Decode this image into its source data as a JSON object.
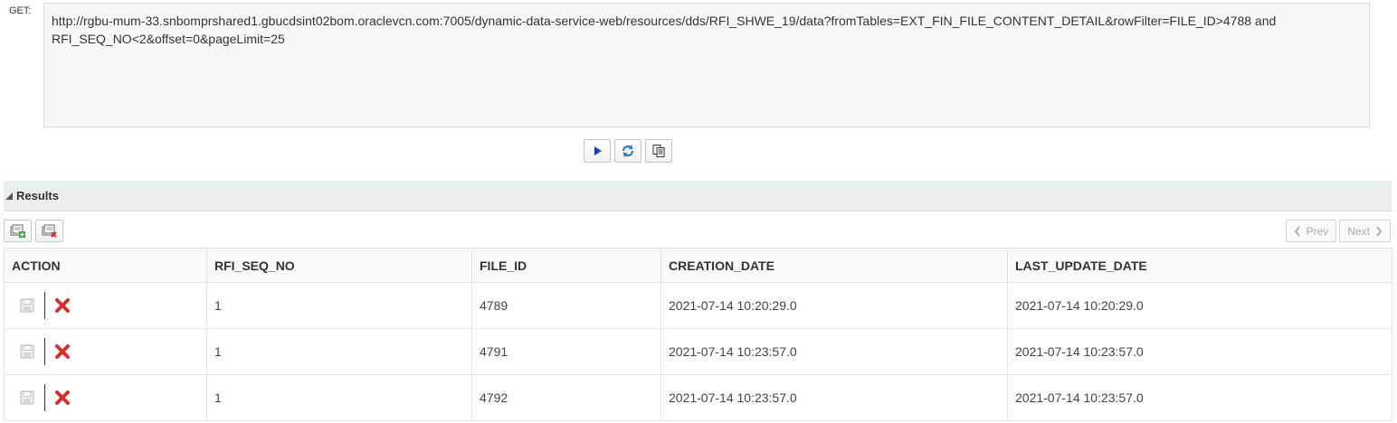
{
  "request": {
    "method_label": "GET:",
    "url": "http://rgbu-mum-33.snbomprshared1.gbucdsint02bom.oraclevcn.com:7005/dynamic-data-service-web/resources/dds/RFI_SHWE_19/data?fromTables=EXT_FIN_FILE_CONTENT_DETAIL&rowFilter=FILE_ID>4788 and RFI_SEQ_NO<2&offset=0&pageLimit=25"
  },
  "toolbar": {
    "icons": [
      "run-icon",
      "refresh-icon",
      "copy-icon"
    ]
  },
  "results": {
    "title": "Results",
    "pager": {
      "prev_label": "Prev",
      "next_label": "Next"
    },
    "columns": [
      "ACTION",
      "RFI_SEQ_NO",
      "FILE_ID",
      "CREATION_DATE",
      "LAST_UPDATE_DATE"
    ],
    "rows": [
      {
        "rfi_seq_no": "1",
        "file_id": "4789",
        "creation_date": "2021-07-14 10:20:29.0",
        "last_update_date": "2021-07-14 10:20:29.0"
      },
      {
        "rfi_seq_no": "1",
        "file_id": "4791",
        "creation_date": "2021-07-14 10:23:57.0",
        "last_update_date": "2021-07-14 10:23:57.0"
      },
      {
        "rfi_seq_no": "1",
        "file_id": "4792",
        "creation_date": "2021-07-14 10:23:57.0",
        "last_update_date": "2021-07-14 10:23:57.0"
      }
    ]
  },
  "colors": {
    "header_bg": "#e9efee",
    "delete_red": "#d32f2f",
    "run_blue": "#1a3fd6"
  }
}
